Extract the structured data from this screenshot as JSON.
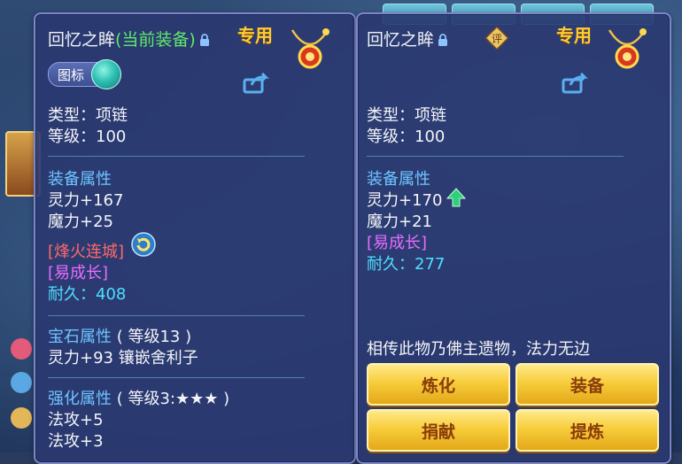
{
  "left": {
    "title": "回忆之眸",
    "title_status": "(当前装备)",
    "exclusive": "专用",
    "toggle_label": "图标",
    "type_line": "类型：项链",
    "level_line": "等级：100",
    "equip_attr_header": "装备属性",
    "attrs": [
      "灵力+167",
      "魔力+25"
    ],
    "special_effect": "[烽火连城]",
    "growth": "[易成长]",
    "durability": "耐久：408",
    "gem_header": "宝石属性",
    "gem_level": "( 等级13 )",
    "gem_line": "灵力+93 镶嵌舍利子",
    "enhance_header": "强化属性",
    "enhance_level": "( 等级3:★★★ )",
    "enhance_attrs": [
      "法攻+5",
      "法攻+3"
    ]
  },
  "right": {
    "title": "回忆之眸",
    "exclusive": "专用",
    "eval_icon": "评",
    "type_line": "类型：项链",
    "level_line": "等级：100",
    "equip_attr_header": "装备属性",
    "attrs": [
      "灵力+170",
      "魔力+21"
    ],
    "growth": "[易成长]",
    "durability": "耐久：277",
    "description": "相传此物乃佛主遗物，法力无边",
    "buttons": [
      "炼化",
      "装备",
      "捐献",
      "提炼"
    ]
  },
  "colors": {
    "panel_bg": "#2a3870",
    "current_equip": "#5fe86a",
    "exclusive": "#ffcc33",
    "header_blue": "#6fc3ff",
    "special_red": "#ff6a6a",
    "growth_pink": "#e86bff",
    "durability_cyan": "#4fdfff",
    "button_gold": "#f7cd3c"
  }
}
